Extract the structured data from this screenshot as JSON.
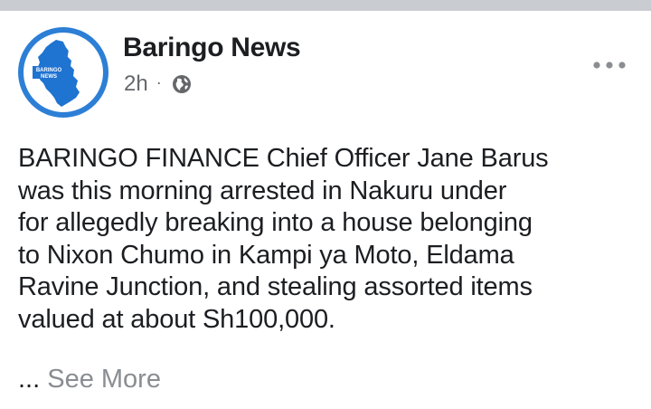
{
  "post": {
    "page_name": "Baringo News",
    "avatar": {
      "logo_text_line1": "BARINGO",
      "logo_text_line2": "NEWS",
      "ring_color": "#2d7fd6",
      "map_color": "#1f73d1"
    },
    "timestamp": "2h",
    "separator": "·",
    "privacy_icon": "globe-icon",
    "more_icon": "more-horizontal-icon",
    "text_lines": [
      "BARINGO FINANCE Chief Officer Jane Barus",
      "was this morning arrested in Nakuru under",
      "for allegedly breaking into a house belonging",
      "to Nixon Chumo in Kampi ya Moto, Eldama",
      "Ravine Junction, and stealing assorted items",
      "valued at about Sh100,000."
    ],
    "ellipsis": "...",
    "see_more_label": "See More"
  },
  "colors": {
    "background": "#c9ccd1",
    "card": "#ffffff",
    "text": "#1c1e21",
    "muted": "#65676b",
    "see_more": "#8a8d91"
  }
}
